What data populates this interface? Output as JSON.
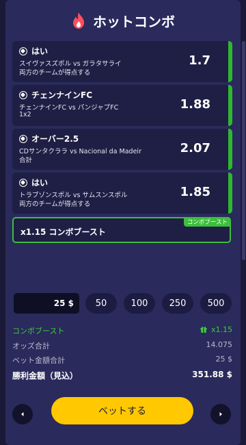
{
  "header": {
    "title": "ホットコンボ"
  },
  "selections": [
    {
      "selection": "はい",
      "match": "スイヴァスズポル vs ガラタサライ",
      "market": "両方のチームが得点する",
      "odds": "1.7"
    },
    {
      "selection": "チェンナインFC",
      "match": "チェンナインFC vs パンジャブFC",
      "market": "1x2",
      "odds": "1.88"
    },
    {
      "selection": "オーバー2.5",
      "match": "CDサンタクララ vs Nacional da Madeir",
      "market": "合計",
      "odds": "2.07"
    },
    {
      "selection": "はい",
      "match": "トラブゾンスポル vs サムスンスポル",
      "market": "両方のチームが得点する",
      "odds": "1.85"
    }
  ],
  "boost": {
    "label": "x1.15 コンボブースト",
    "tag": "コンボブースト"
  },
  "stake": {
    "value": "25 $",
    "chips": [
      "50",
      "100",
      "250",
      "500"
    ]
  },
  "summary": {
    "boost_label": "コンボブースト",
    "boost_value": "x1.15",
    "odds_label": "オッズ合計",
    "odds_value": "14.075",
    "stake_label": "ベット金額合計",
    "stake_value": "25 $",
    "win_label": "勝利金額（見込）",
    "win_value": "351.88 $"
  },
  "bet_button": "ベットする",
  "colors": {
    "accent": "#ffc800",
    "boost": "#3cbf3c",
    "panel": "#2a2a5c"
  }
}
